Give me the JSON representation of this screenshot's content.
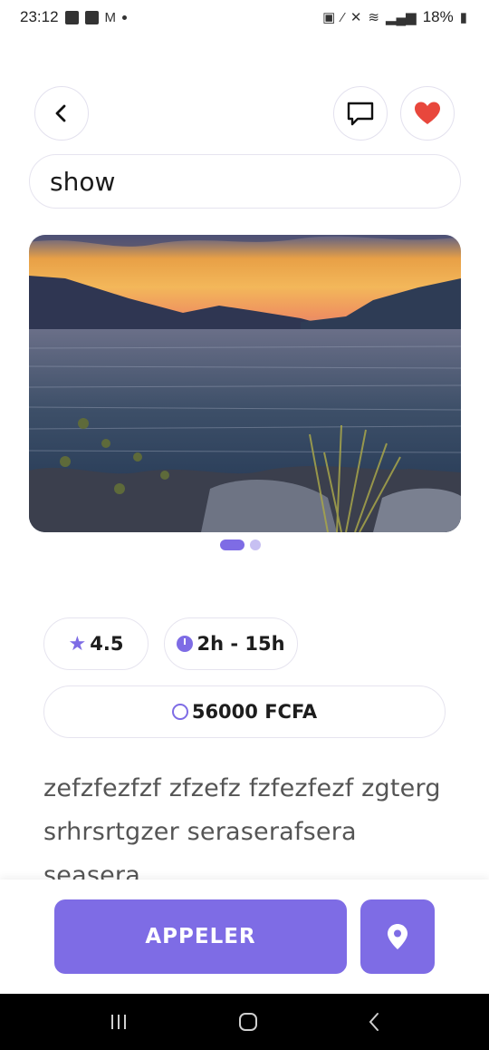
{
  "status_bar": {
    "time": "23:12",
    "battery": "18%"
  },
  "header": {
    "back_icon": "chevron-left-icon",
    "message_icon": "chat-bubble-icon",
    "favorite_icon": "heart-icon",
    "favorite_color": "#e8473c"
  },
  "title": {
    "value": "show"
  },
  "gallery": {
    "image_subject": "lake sunset",
    "pages": 2,
    "active_page": 1
  },
  "info": {
    "rating": "4.5",
    "hours": "2h - 15h",
    "price": "56000 FCFA"
  },
  "description": {
    "text": "zefzfezfzf zfzefz fzfezfezf zgterg srhrsrtgzer seraserafsera seasera"
  },
  "actions": {
    "call_label": "APPELER",
    "map_icon": "map-pin-icon"
  },
  "colors": {
    "accent": "#7e6ce5",
    "accent_light": "#c7c0f2"
  }
}
